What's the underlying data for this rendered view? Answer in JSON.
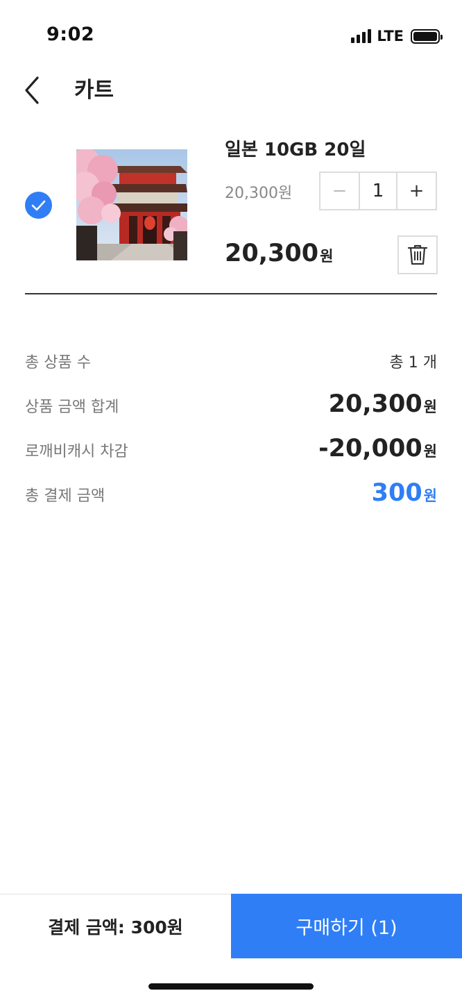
{
  "status": {
    "time": "9:02",
    "network": "LTE"
  },
  "header": {
    "title": "카트"
  },
  "cart_item": {
    "title": "일본 10GB 20일",
    "unit_price": "20,300원",
    "quantity": "1",
    "minus_label": "−",
    "plus_label": "+",
    "total_number": "20,300",
    "total_unit": "원",
    "checked": true
  },
  "summary": {
    "rows": [
      {
        "label": "총 상품 수",
        "value": "총 1 개"
      },
      {
        "label": "상품 금액 합계",
        "number": "20,300",
        "unit": "원"
      },
      {
        "label": "로깨비캐시 차감",
        "number": "-20,000",
        "unit": "원"
      },
      {
        "label": "총 결제 금액",
        "number": "300",
        "unit": "원"
      }
    ]
  },
  "footer": {
    "pay_label": "결제 금액: 300원",
    "buy_label": "구매하기 (1)"
  },
  "colors": {
    "accent": "#2f7ef5",
    "text": "#222222",
    "muted": "#777777",
    "border": "#dcdcdc"
  },
  "icons": [
    "back-icon",
    "check-icon",
    "trash-icon",
    "signal-icon",
    "battery-icon"
  ]
}
